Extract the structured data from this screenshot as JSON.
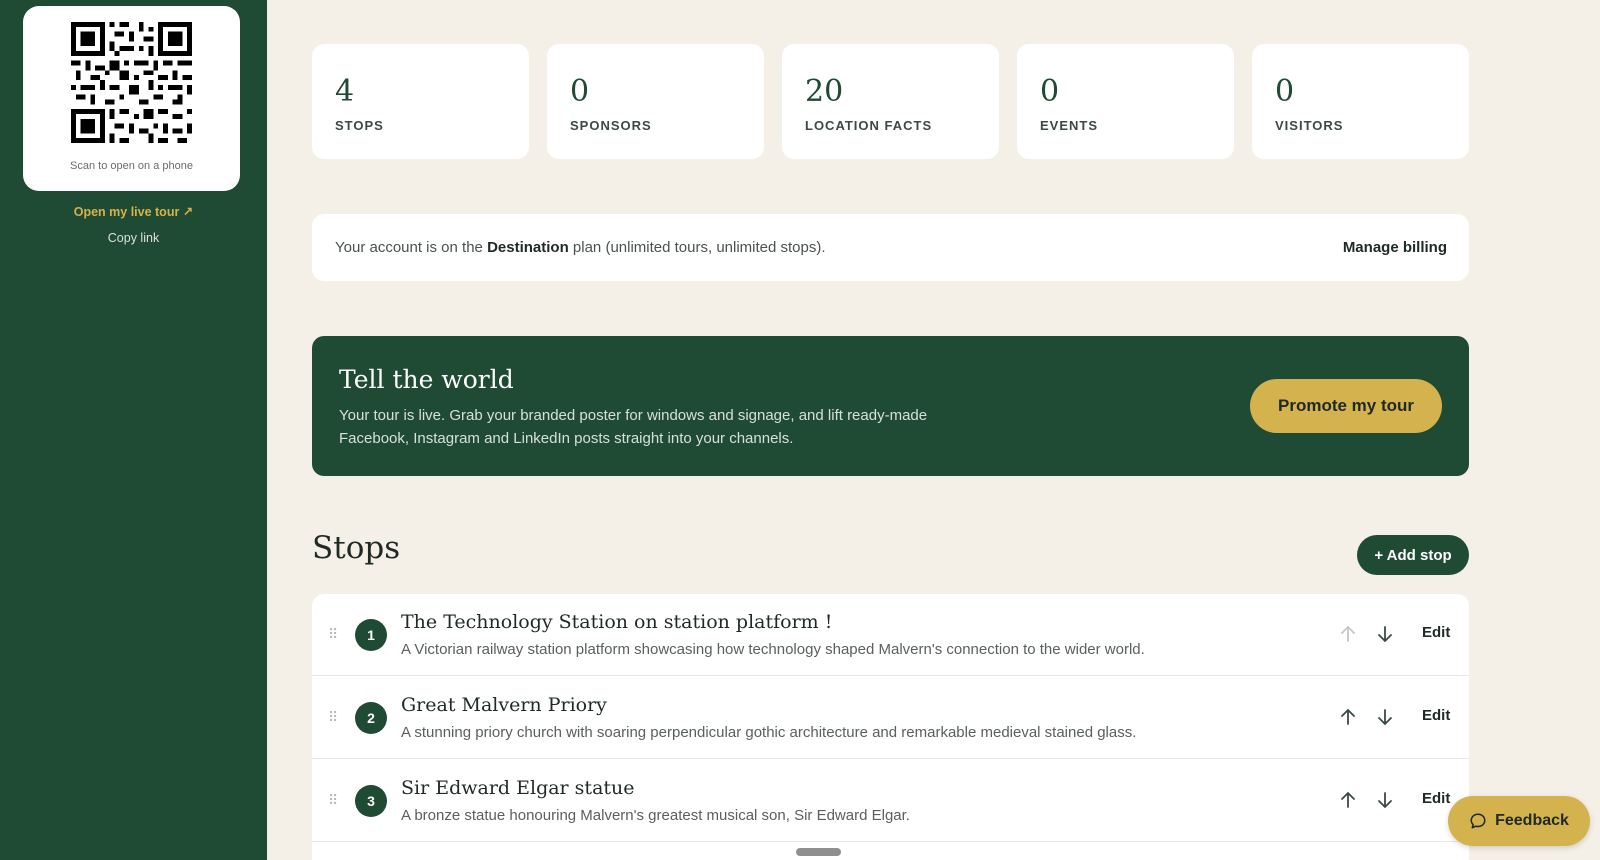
{
  "sidebar": {
    "qr_caption": "Scan to open on a phone",
    "open_live_tour": "Open my live tour ↗",
    "copy_link": "Copy link"
  },
  "stats": [
    {
      "value": "4",
      "label": "STOPS"
    },
    {
      "value": "0",
      "label": "SPONSORS"
    },
    {
      "value": "20",
      "label": "LOCATION FACTS"
    },
    {
      "value": "0",
      "label": "EVENTS"
    },
    {
      "value": "0",
      "label": "VISITORS"
    }
  ],
  "plan": {
    "prefix": "Your account is on the ",
    "plan_name": "Destination",
    "suffix": " plan (unlimited tours, unlimited stops).",
    "manage_billing": "Manage billing"
  },
  "promo": {
    "title": "Tell the world",
    "body": "Your tour is live. Grab your branded poster for windows and signage, and lift ready-made Facebook, Instagram and LinkedIn posts straight into your channels.",
    "button": "Promote my tour"
  },
  "stops": {
    "heading": "Stops",
    "add_button": "+ Add stop",
    "edit_label": "Edit",
    "items": [
      {
        "number": "1",
        "title": "The Technology Station on station platform !",
        "description": "A Victorian railway station platform showcasing how technology shaped Malvern's connection to the wider world."
      },
      {
        "number": "2",
        "title": "Great Malvern Priory",
        "description": "A stunning priory church with soaring perpendicular gothic architecture and remarkable medieval stained glass."
      },
      {
        "number": "3",
        "title": "Sir Edward Elgar statue",
        "description": "A bronze statue honouring Malvern's greatest musical son, Sir Edward Elgar."
      }
    ]
  },
  "feedback": {
    "label": "Feedback"
  },
  "colors": {
    "sidebar_green": "#1f4a33",
    "background": "#f4efe7",
    "accent_gold": "#d4b24e",
    "link_gold": "#d6b24a"
  }
}
